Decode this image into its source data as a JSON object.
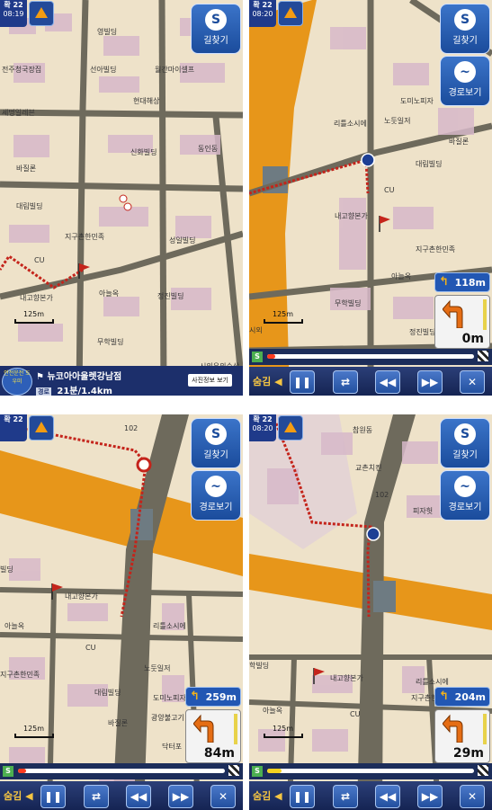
{
  "common": {
    "zoom_level": "확 22",
    "btn_route_search": "길찾기",
    "btn_route_view": "경로보기",
    "hide_label": "숨김",
    "scale_label": "125m",
    "ctrl_pause": "❚❚",
    "ctrl_repeat": "⇄",
    "ctrl_rewind": "◀◀",
    "ctrl_forward": "▶▶",
    "ctrl_close": "✕",
    "start_marker": "S"
  },
  "panel1": {
    "time": "08:19",
    "destination": "뉴코아아울렛강남점",
    "route_tag": "경로",
    "eta": "21분/1.4km",
    "photo_button": "사진정보 보기",
    "badge_text": "안전운전 도우미",
    "labels": [
      "영빌딩",
      "전주청국장집",
      "선아빌딩",
      "월간마이셀프",
      "세명일레븐",
      "현대해상",
      "신화빌딩",
      "동인동",
      "바질론",
      "대림빌딩",
      "지구촌한민족",
      "성일빌딩",
      "CU",
      "내고향본가",
      "아늘옥",
      "정진빌딩",
      "무학빌딩",
      "시외우외수산"
    ]
  },
  "panel2": {
    "time": "08:20",
    "next_turn_distance": "118m",
    "current_distance": "0m",
    "progress_percent": 4,
    "labels": [
      "리틀소시에",
      "도미노피자",
      "노둣일저",
      "바질론",
      "대림빌딩",
      "CU",
      "내고향본가",
      "지구촌한민족",
      "아늘옥",
      "무학빌딩",
      "정진빌딩",
      "시외"
    ]
  },
  "panel3": {
    "time": "",
    "next_turn_distance": "259m",
    "current_distance": "84m",
    "progress_percent": 4,
    "labels": [
      "102",
      "빌딩",
      "내고향본가",
      "리틀소시에",
      "아늘옥",
      "CU",
      "노둣일저",
      "지구촌한민족",
      "대림빌딩",
      "도미노피자",
      "광양불고기",
      "바질론",
      "닥터포"
    ]
  },
  "panel4": {
    "time": "08:20",
    "next_turn_distance": "204m",
    "current_distance": "29m",
    "progress_percent": 7,
    "labels": [
      "참원동",
      "교촌치킨",
      "102",
      "피자헛",
      "학빌딩",
      "내고향본가",
      "리틀소시에",
      "아늘옥",
      "지구촌한민족",
      "CU"
    ]
  }
}
